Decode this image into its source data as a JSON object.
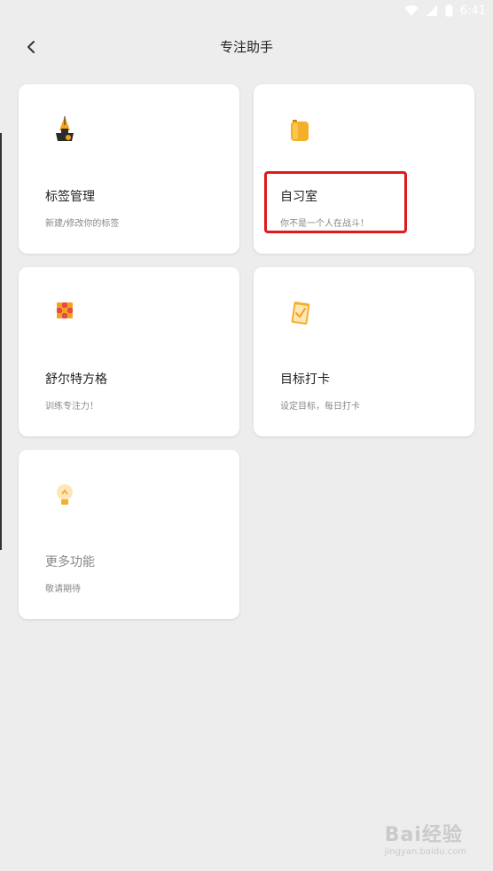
{
  "status_bar": {
    "time": "6:41"
  },
  "header": {
    "title": "专注助手"
  },
  "cards": [
    {
      "title": "标签管理",
      "subtitle": "新建/修改你的标签",
      "icon": "pen-nib-icon"
    },
    {
      "title": "自习室",
      "subtitle": "你不是一个人在战斗！",
      "icon": "backpack-icon"
    },
    {
      "title": "舒尔特方格",
      "subtitle": "训练专注力！",
      "icon": "grid-squares-icon"
    },
    {
      "title": "目标打卡",
      "subtitle": "设定目标，每日打卡",
      "icon": "clipboard-check-icon"
    },
    {
      "title": "更多功能",
      "subtitle": "敬请期待",
      "icon": "lightbulb-icon"
    }
  ],
  "watermark": {
    "brand": "Bai经验",
    "url": "jingyan.baidu.com"
  },
  "colors": {
    "highlight": "#e01a1a",
    "icon_accent": "#f4a21c",
    "background": "#ededed"
  }
}
